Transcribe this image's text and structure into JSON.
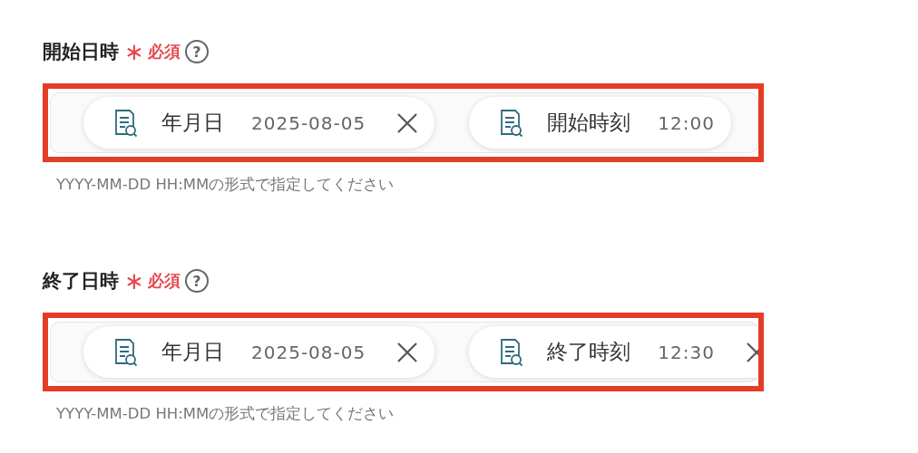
{
  "fields": [
    {
      "label": "開始日時",
      "required_mark": "∗",
      "required_text": "必須",
      "help": "?",
      "chips": [
        {
          "label": "年月日",
          "value": "2025-08-05",
          "clear_icon": true
        },
        {
          "label": "開始時刻",
          "value": "12:00",
          "clear_icon": false
        }
      ],
      "hint": "YYYY-MM-DD HH:MMの形式で指定してください"
    },
    {
      "label": "終了日時",
      "required_mark": "∗",
      "required_text": "必須",
      "help": "?",
      "chips": [
        {
          "label": "年月日",
          "value": "2025-08-05",
          "clear_icon": true
        },
        {
          "label": "終了時刻",
          "value": "12:30",
          "clear_icon": true
        }
      ],
      "hint": "YYYY-MM-DD HH:MMの形式で指定してください"
    }
  ]
}
